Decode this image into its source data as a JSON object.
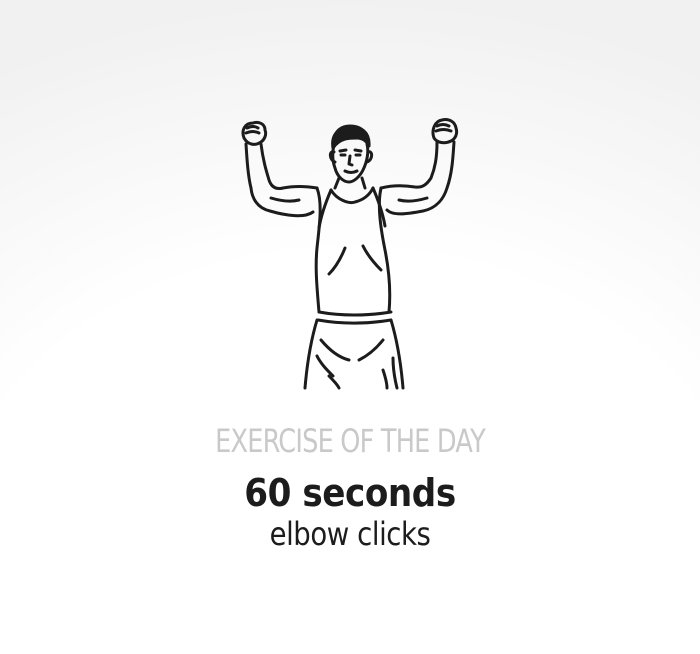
{
  "card": {
    "kicker": "EXERCISE OF THE DAY",
    "duration": "60 seconds",
    "exercise": "elbow clicks"
  },
  "illustration": {
    "icon": "man-flexing-arms-icon"
  },
  "colors": {
    "ink": "#1c1c1c",
    "muted": "#c9c9c9",
    "background": "#ffffff"
  }
}
